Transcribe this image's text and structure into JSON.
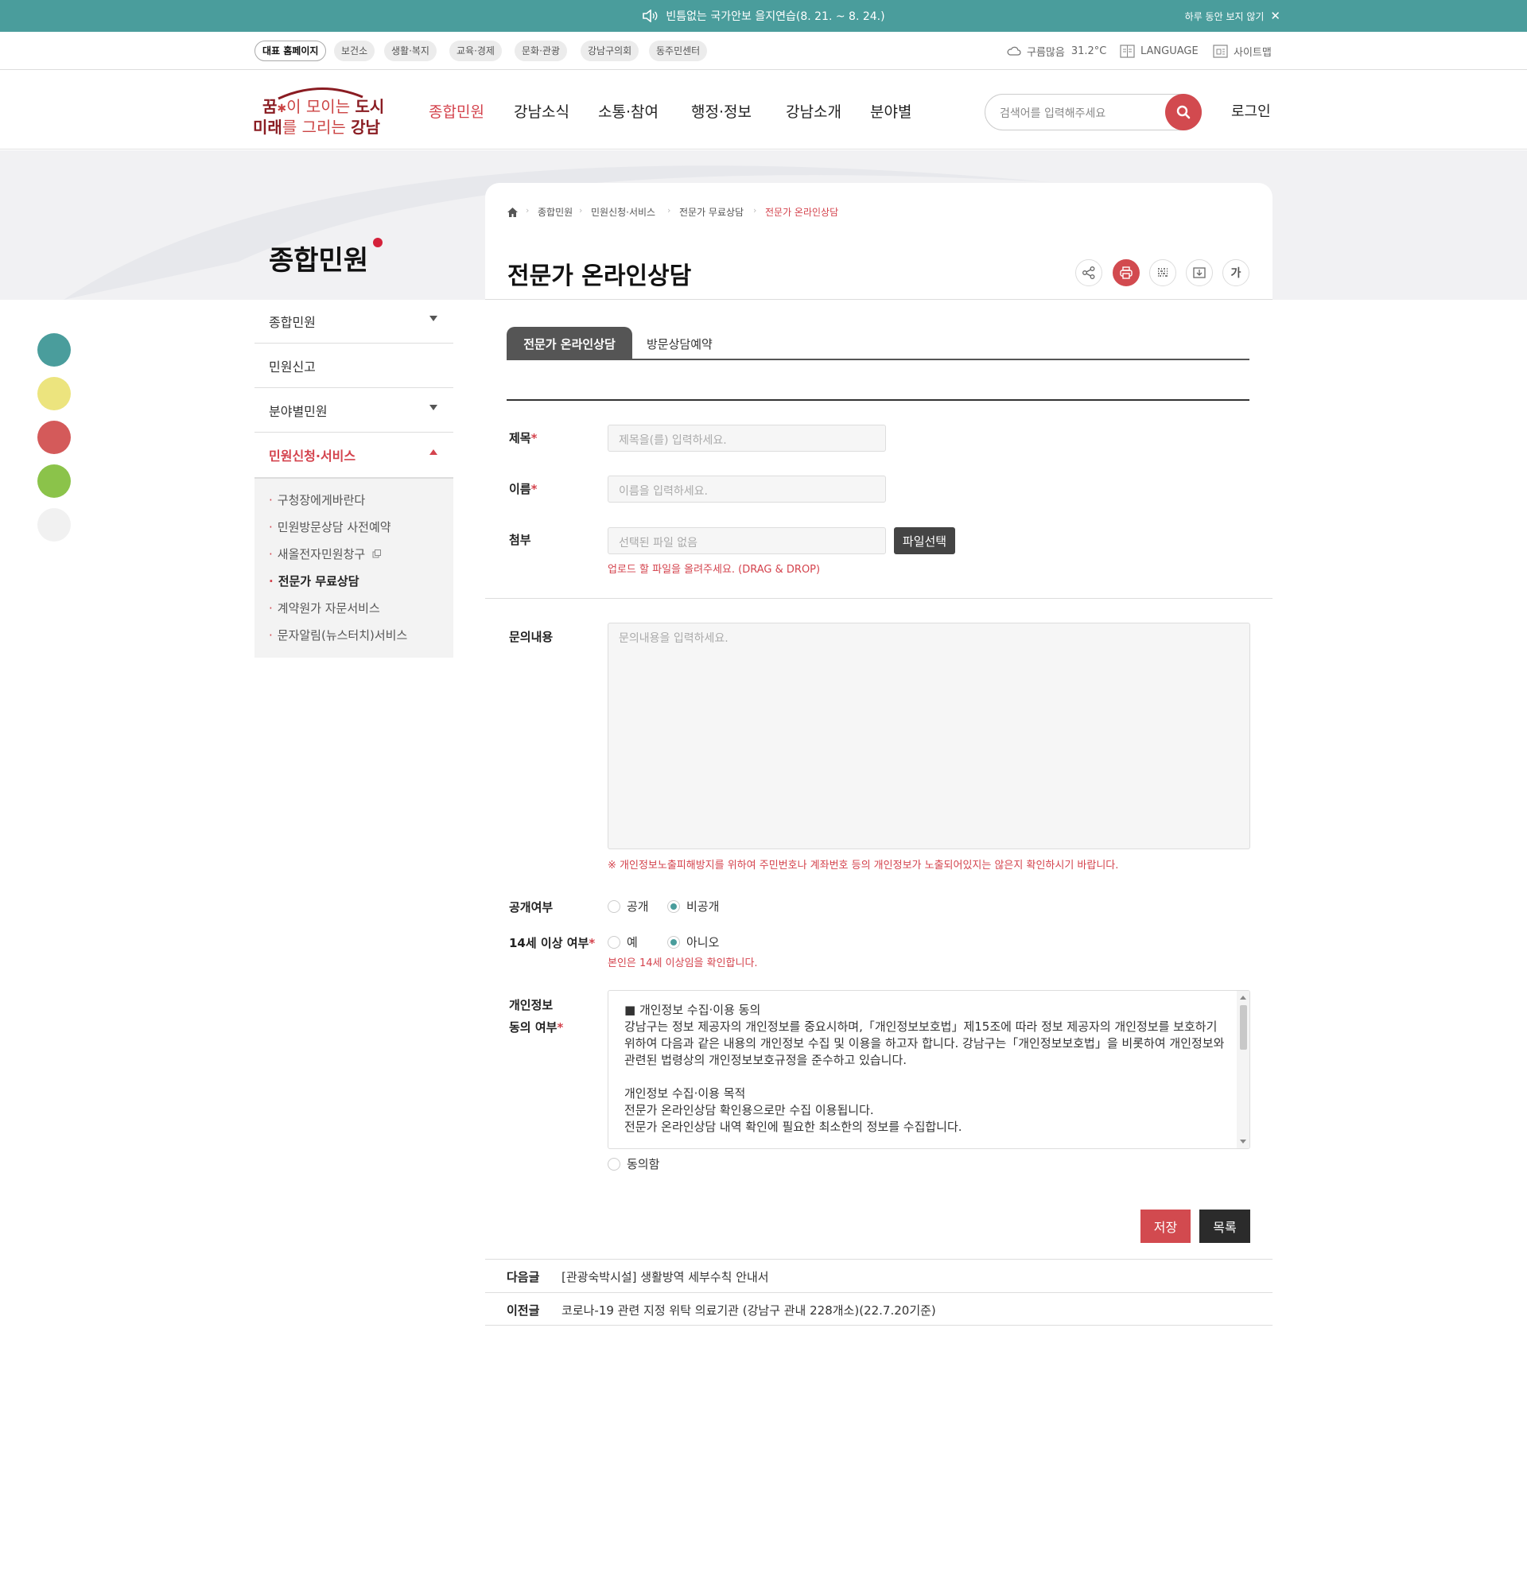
{
  "notice": {
    "message": "빈틈없는 국가안보 을지연습(8. 21. ~ 8. 24.)",
    "close_label": "하루 동안 보지 않기"
  },
  "util": {
    "sites": [
      "대표 홈페이지",
      "보건소",
      "생활·복지",
      "교육·경제",
      "문화·관광",
      "강남구의회",
      "동주민센터"
    ],
    "weather_label": "구름많음",
    "temperature": "31.2°C",
    "language": "LANGUAGE",
    "sitemap": "사이트맵"
  },
  "header": {
    "logo": {
      "line1_a": "꿈",
      "line1_b": "이 모이는 ",
      "line1_c": "도시",
      "line2_a": "미래",
      "line2_b": "를 그리는 ",
      "line2_c": "강남"
    },
    "gnb": [
      "종합민원",
      "강남소식",
      "소통·참여",
      "행정·정보",
      "강남소개",
      "분야별"
    ],
    "search_placeholder": "검색어를 입력해주세요",
    "login": "로그인"
  },
  "section_title": "종합민원",
  "breadcrumb": [
    "종합민원",
    "민원신청·서비스",
    "전문가 무료상담",
    "전문가 온라인상담"
  ],
  "page_title": "전문가 온라인상담",
  "font_tool": "가",
  "side_dot_colors": [
    "#4a9d9c",
    "#ece47e",
    "#d45a5a",
    "#8bc34a",
    "#f1f1f1"
  ],
  "lnb": {
    "items": [
      "종합민원",
      "민원신고",
      "분야별민원",
      "민원신청·서비스"
    ],
    "sub_items": [
      "구청장에게바란다",
      "민원방문상담 사전예약",
      "새올전자민원창구",
      "전문가 무료상담",
      "계약원가 자문서비스",
      "문자알림(뉴스터치)서비스"
    ]
  },
  "tabs": [
    "전문가 온라인상담",
    "방문상담예약"
  ],
  "form": {
    "title_label": "제목",
    "title_placeholder": "제목을(를) 입력하세요.",
    "name_label": "이름",
    "name_placeholder": "이름을 입력하세요.",
    "attach_label": "첨부",
    "attach_placeholder": "선택된 파일 없음",
    "file_button": "파일선택",
    "upload_note": "업로드 할 파일을 올려주세요. (DRAG & DROP)",
    "content_label": "문의내용",
    "content_placeholder": "문의내용을 입력하세요.",
    "privacy_warning": "※ 개인정보노출피해방지를 위하여 주민번호나 계좌번호 등의 개인정보가 노출되어있지는 않은지 확인하시기 바랍니다.",
    "public_label": "공개여부",
    "public_options": [
      "공개",
      "비공개"
    ],
    "public_selected": "비공개",
    "age_label": "14세 이상 여부",
    "age_options": [
      "예",
      "아니오"
    ],
    "age_selected": "아니오",
    "age_note": "본인은 14세 이상임을 확인합니다.",
    "consent_label_1": "개인정보",
    "consent_label_2": "동의 여부",
    "required_mark": "*",
    "terms_text": "■ 개인정보 수집·이용 동의\n강남구는 정보 제공자의 개인정보를 중요시하며,「개인정보보호법」제15조에 따라 정보 제공자의 개인정보를 보호하기 위하여 다음과 같은 내용의 개인정보 수집 및 이용을 하고자 합니다. 강남구는「개인정보보호법」을 비롯하여 개인정보와 관련된 법령상의 개인정보보호규정을 준수하고 있습니다.\n\n개인정보 수집·이용 목적\n전문가 온라인상담 확인용으로만 수집 이용됩니다.\n전문가 온라인상담 내역 확인에 필요한 최소한의 정보를 수집합니다.",
    "consent_option": "동의함"
  },
  "buttons": {
    "save": "저장",
    "list": "목록"
  },
  "post_nav": {
    "next_label": "다음글",
    "next_title": "[관광숙박시설] 생활방역 세부수칙 안내서",
    "prev_label": "이전글",
    "prev_title": "코로나-19 관련 지정 위탁 의료기관 (강남구 관내 228개소)(22.7.20기준)"
  }
}
